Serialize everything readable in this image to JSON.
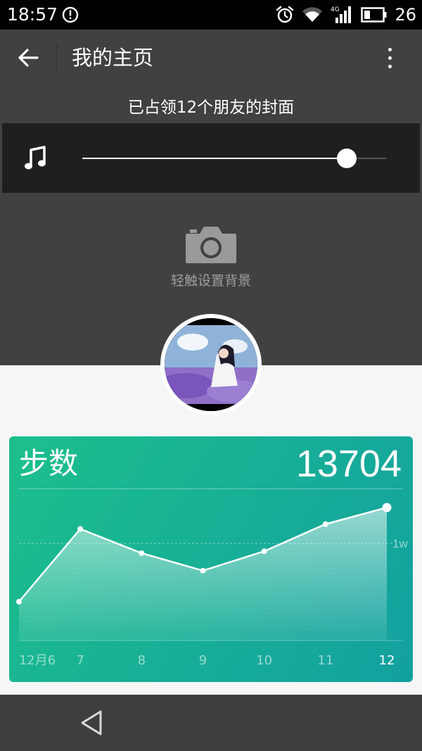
{
  "status_bar": {
    "time": "18:57",
    "network": "4G",
    "battery_level": "26",
    "icons": [
      "alert-icon",
      "alarm-icon",
      "wifi-icon",
      "signal-icon",
      "battery-icon"
    ]
  },
  "app_bar": {
    "title": "我的主页",
    "back_icon": "back-arrow-icon",
    "menu_icon": "more-vertical-icon"
  },
  "cover": {
    "info_text": "已占领12个朋友的封面",
    "music_icon": "music-note-icon",
    "music_progress": 0.87,
    "set_background_label": "轻触设置背景",
    "camera_icon": "camera-icon"
  },
  "avatar": {
    "icon": "avatar-image"
  },
  "steps_card": {
    "title": "步数",
    "count": "13704",
    "gradient_start": "#1cbf8c",
    "gradient_end": "#13a0a0"
  },
  "chart_data": {
    "type": "area",
    "categories": [
      "12月6",
      "7",
      "8",
      "9",
      "10",
      "11",
      "12"
    ],
    "values": [
      4000,
      11500,
      9000,
      7200,
      9200,
      12000,
      13704
    ],
    "reference_line": {
      "value": 10000,
      "label": "1w"
    },
    "ylim": [
      0,
      15600
    ],
    "highlight_index": 6
  },
  "nav_bar": {
    "back_icon": "nav-back-icon"
  }
}
